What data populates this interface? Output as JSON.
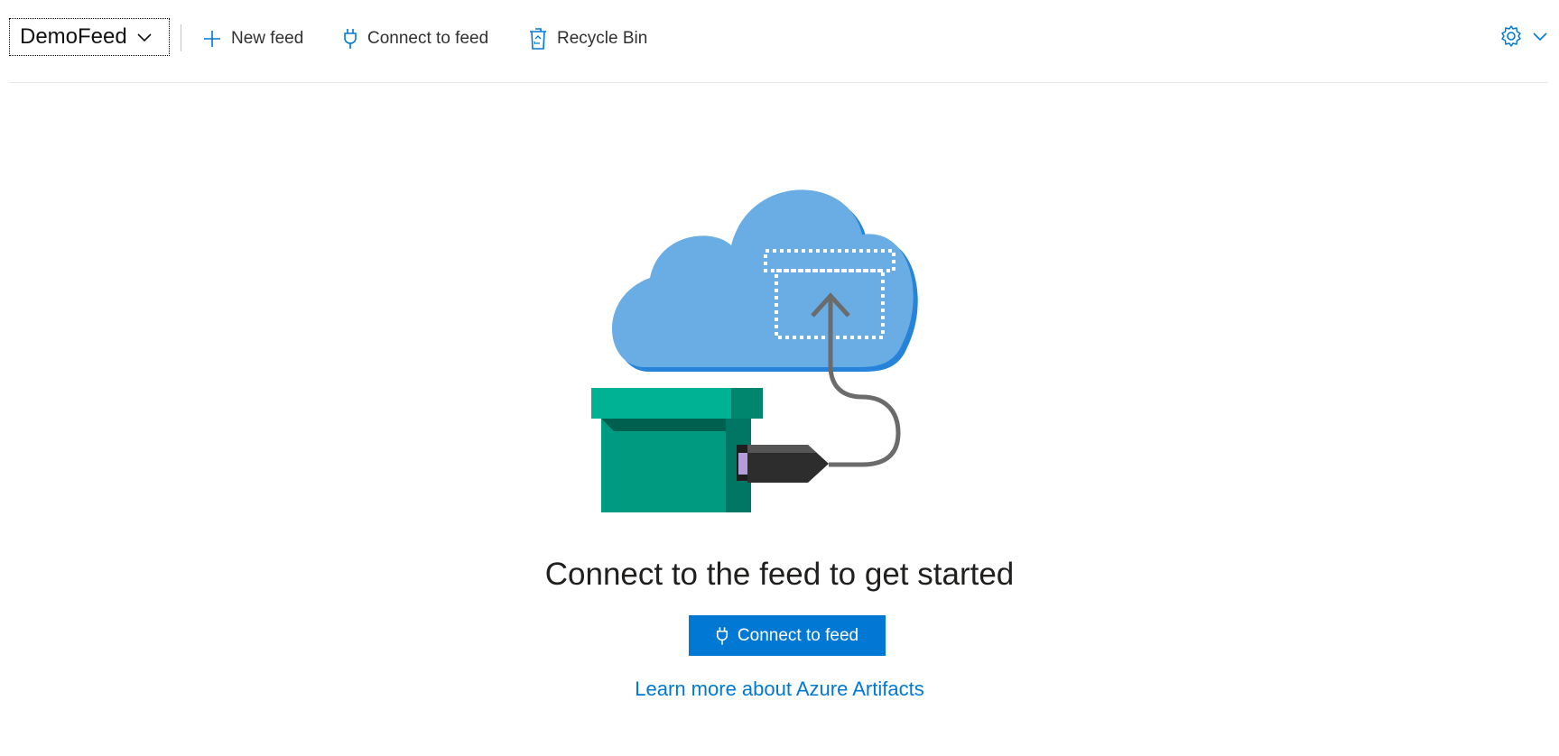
{
  "toolbar": {
    "feed_name": "DemoFeed",
    "new_feed_label": "New feed",
    "connect_label": "Connect to feed",
    "recycle_bin_label": "Recycle Bin"
  },
  "main": {
    "title": "Connect to the feed to get started",
    "connect_button_label": "Connect to feed",
    "learn_more_link": "Learn more about Azure Artifacts"
  },
  "icons": {
    "feed_dropdown": "chevron-down-icon",
    "new_feed": "plus-icon",
    "connect": "plug-icon",
    "recycle_bin": "recycle-bin-icon",
    "settings": "gear-icon",
    "settings_dropdown": "chevron-down-icon"
  },
  "colors": {
    "accent": "#0078d4",
    "cloud": "#69ade4",
    "box": "#009a80"
  }
}
